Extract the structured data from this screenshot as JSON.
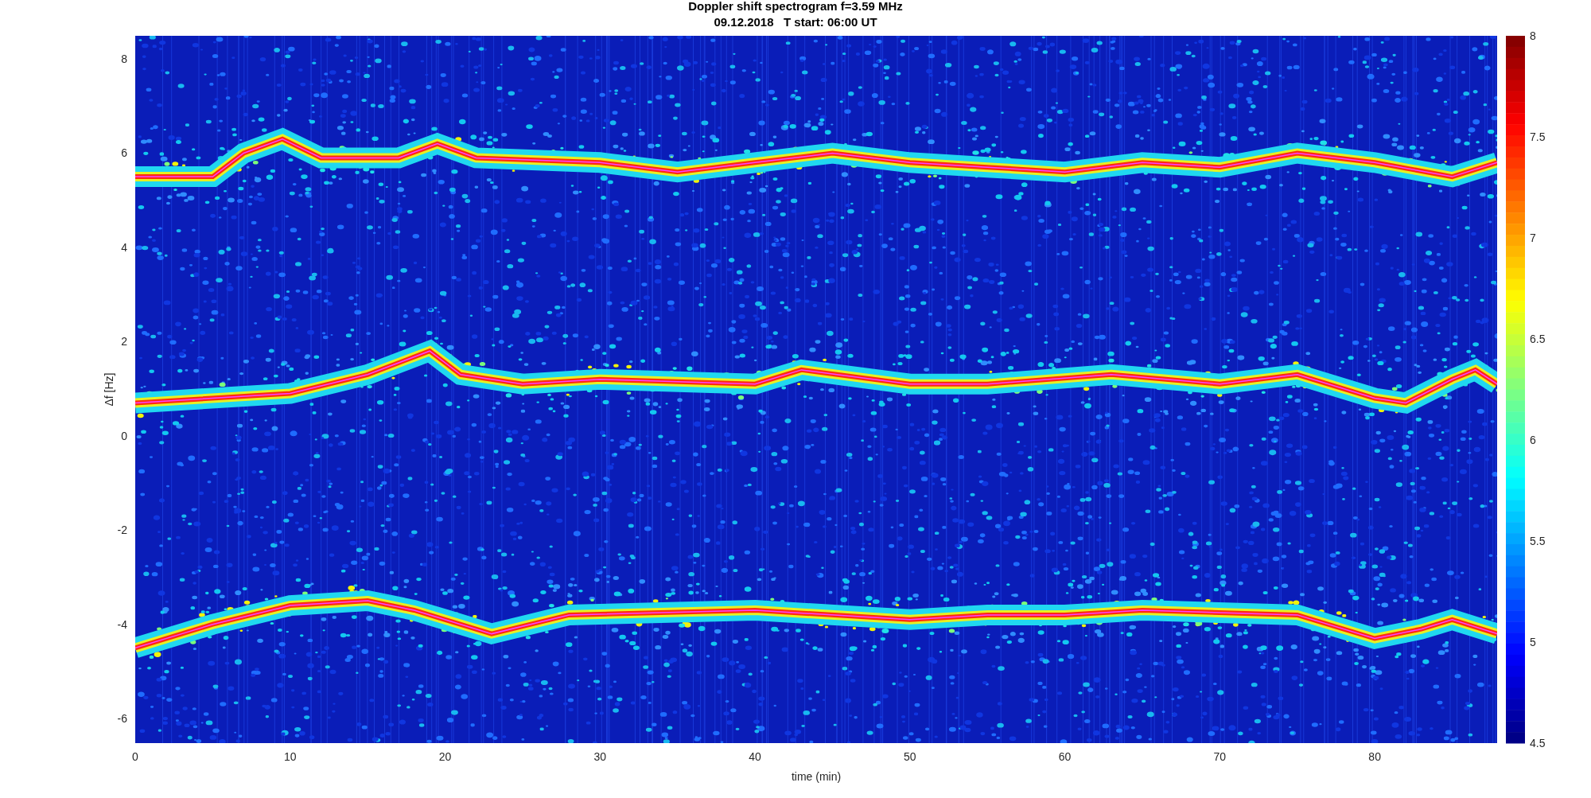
{
  "figure": {
    "title": "Doppler shift spectrogram f=3.59 MHz",
    "subtitle": "09.12.2018   T start: 06:00 UT"
  },
  "axes": {
    "xlabel": "time (min)",
    "ylabel": "Δf [Hz]",
    "xticks": [
      "0",
      "10",
      "20",
      "30",
      "40",
      "50",
      "60",
      "70",
      "80"
    ],
    "yticks": [
      "8",
      "6",
      "4",
      "2",
      "0",
      "-2",
      "-4",
      "-6"
    ]
  },
  "colorbar": {
    "ticks": [
      "8",
      "7.5",
      "7",
      "6.5",
      "6",
      "5.5",
      "5",
      "4.5"
    ]
  }
}
